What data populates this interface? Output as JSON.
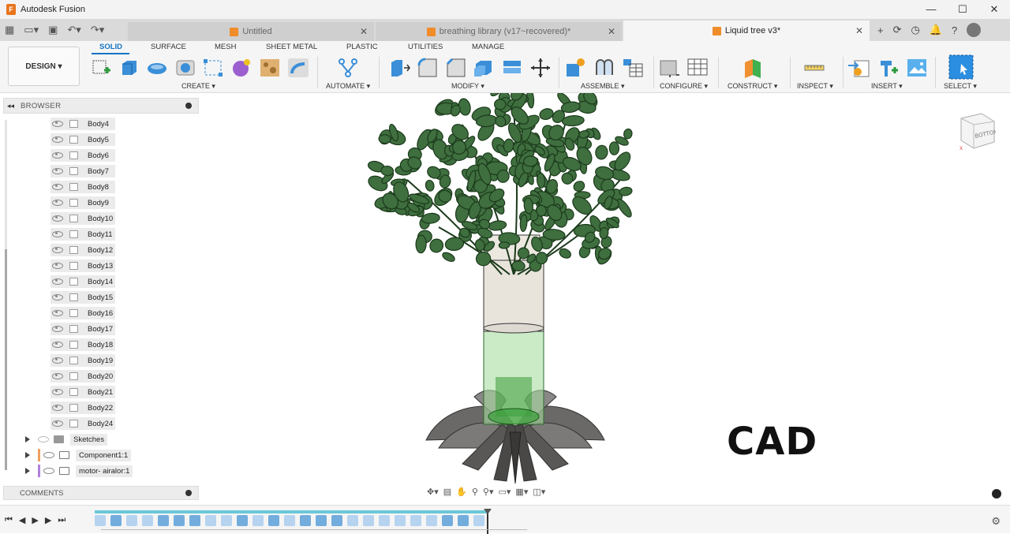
{
  "app": {
    "title": "Autodesk Fusion"
  },
  "tabs": [
    {
      "label": "Untitled",
      "active": false
    },
    {
      "label": "breathing library (v17~recovered)*",
      "active": false
    },
    {
      "label": "Liquid tree v3*",
      "active": true
    }
  ],
  "ribbon": {
    "design_label": "DESIGN ▾",
    "workspace_tabs": [
      "SOLID",
      "SURFACE",
      "MESH",
      "SHEET METAL",
      "PLASTIC",
      "UTILITIES",
      "MANAGE"
    ],
    "groups": [
      "CREATE ▾",
      "AUTOMATE ▾",
      "MODIFY ▾",
      "ASSEMBLE ▾",
      "CONFIGURE ▾",
      "CONSTRUCT ▾",
      "INSPECT ▾",
      "INSERT ▾",
      "SELECT ▾"
    ]
  },
  "browser": {
    "title": "BROWSER",
    "bodies": [
      "Body4",
      "Body5",
      "Body6",
      "Body7",
      "Body8",
      "Body9",
      "Body10",
      "Body11",
      "Body12",
      "Body13",
      "Body14",
      "Body15",
      "Body16",
      "Body17",
      "Body18",
      "Body19",
      "Body20",
      "Body21",
      "Body22",
      "Body24"
    ],
    "nodes": [
      {
        "label": "Sketches",
        "color": ""
      },
      {
        "label": "Component1:1",
        "color": "#f0a060"
      },
      {
        "label": "motor- airalor:1",
        "color": "#b080e0"
      }
    ]
  },
  "comments": {
    "title": "COMMENTS"
  },
  "viewport": {
    "overlay_text": "CAD",
    "viewcube_label": "BOTTOM"
  },
  "colors": {
    "accent": "#1474c4",
    "leaf": "#3f6e3f",
    "leaf_dark": "#1b3a1b",
    "vase": "#e8e4dc",
    "glass": "#8fd08f",
    "base": "#5a5856"
  }
}
